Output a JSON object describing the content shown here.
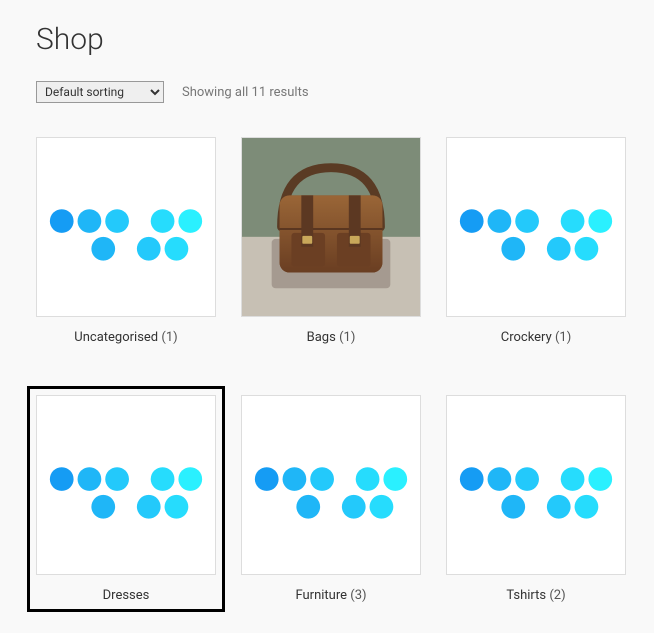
{
  "page": {
    "title": "Shop"
  },
  "controls": {
    "sort_default": "Default sorting",
    "results_text": "Showing all 11 results"
  },
  "categories": [
    {
      "name": "Uncategorised",
      "count": "(1)",
      "image": "placeholder"
    },
    {
      "name": "Bags",
      "count": "(1)",
      "image": "bag"
    },
    {
      "name": "Crockery",
      "count": "(1)",
      "image": "placeholder"
    },
    {
      "name": "Dresses",
      "count": "",
      "image": "placeholder",
      "selected": true
    },
    {
      "name": "Furniture",
      "count": "(3)",
      "image": "placeholder"
    },
    {
      "name": "Tshirts",
      "count": "(2)",
      "image": "placeholder"
    }
  ]
}
